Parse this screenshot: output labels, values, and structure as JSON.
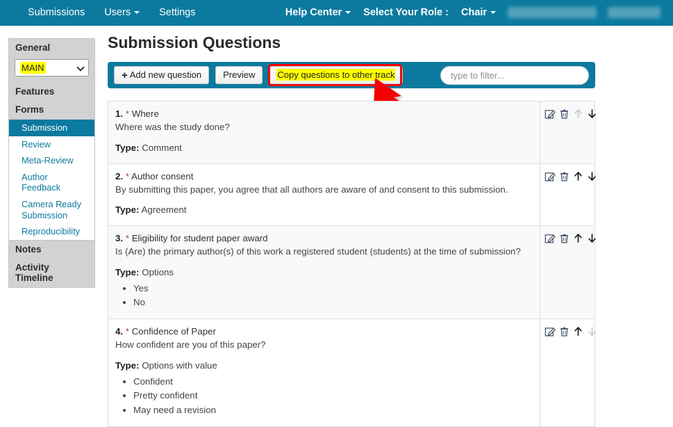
{
  "navbar": {
    "left_items": [
      {
        "label": "Submissions",
        "caret": false
      },
      {
        "label": "Users",
        "caret": true
      },
      {
        "label": "Settings",
        "caret": false
      }
    ],
    "help_center": "Help Center",
    "role_label": "Select Your Role :",
    "role_value": "Chair",
    "background_color": "#0b7a9e"
  },
  "sidebar": {
    "general_header": "General",
    "track_select": {
      "value": "MAIN",
      "highlight_color": "#ffff00"
    },
    "features_header": "Features",
    "forms_header": "Forms",
    "forms": [
      {
        "label": "Submission",
        "active": true
      },
      {
        "label": "Review",
        "active": false
      },
      {
        "label": "Meta-Review",
        "active": false
      },
      {
        "label": "Author Feedback",
        "active": false
      },
      {
        "label": "Camera Ready Submission",
        "active": false
      },
      {
        "label": "Reproducibility",
        "active": false
      }
    ],
    "notes_header": "Notes",
    "activity_header": "Activity Timeline",
    "active_color": "#0b7a9e"
  },
  "main": {
    "title": "Submission Questions",
    "toolbar": {
      "add_label": "Add new question",
      "add_plus": "+",
      "preview_label": "Preview",
      "copy_label": "Copy questions to other track",
      "copy_highlighted": true,
      "filter_placeholder": "type to filter...",
      "filter_value": ""
    },
    "questions": [
      {
        "number": "1.",
        "star": "*",
        "title": "Where",
        "description": "Where was the study done?",
        "type_label": "Type:",
        "type_value": "Comment",
        "options": [],
        "actions": {
          "edit": "edit-icon",
          "delete": "trash-icon",
          "move_up_enabled": false,
          "move_down_enabled": true
        }
      },
      {
        "number": "2.",
        "star": "*",
        "title": "Author consent",
        "description": "By submitting this paper, you agree that all authors are aware of and consent to this submission.",
        "type_label": "Type:",
        "type_value": "Agreement",
        "options": [],
        "actions": {
          "edit": "edit-icon",
          "delete": "trash-icon",
          "move_up_enabled": true,
          "move_down_enabled": true
        }
      },
      {
        "number": "3.",
        "star": "*",
        "title": "Eligibility for student paper award",
        "description": "Is (Are) the primary author(s) of this work a registered student (students) at the time of submission?",
        "type_label": "Type:",
        "type_value": "Options",
        "options": [
          "Yes",
          "No"
        ],
        "actions": {
          "edit": "edit-icon",
          "delete": "trash-icon",
          "move_up_enabled": true,
          "move_down_enabled": true
        }
      },
      {
        "number": "4.",
        "star": "*",
        "title": "Confidence of Paper",
        "description": "How confident are you of this paper?",
        "type_label": "Type:",
        "type_value": "Options with value",
        "options": [
          "Confident",
          "Pretty confident",
          "May need a revision"
        ],
        "actions": {
          "edit": "edit-icon",
          "delete": "trash-icon",
          "move_up_enabled": true,
          "move_down_enabled": false
        }
      }
    ]
  },
  "annotation": {
    "box_color": "#f40000",
    "arrow_color": "#f40000",
    "target": "copy-questions-to-other-track-button"
  }
}
